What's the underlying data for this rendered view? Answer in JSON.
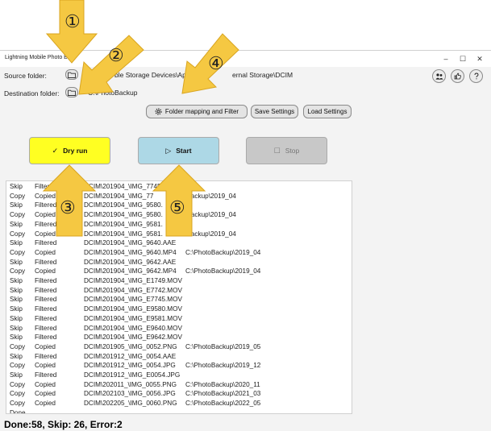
{
  "window": {
    "title": "Lightning Mobile Photo Ba",
    "controls": [
      "–",
      "☐",
      "✕"
    ]
  },
  "source": {
    "label": "Source folder:",
    "path": "ble Storage Devices\\App",
    "path_tail": "ernal Storage\\DCIM"
  },
  "destination": {
    "label": "Destination folder:",
    "path": "C:\\PhotoBackup"
  },
  "toolbar": {
    "mapping_label": "Folder mapping and Filter",
    "save_label": "Save Settings",
    "load_label": "Load Settings"
  },
  "actions": {
    "dry_run": "Dry run",
    "start": "Start",
    "stop": "Stop"
  },
  "colors": {
    "dry_run_bg": "#ffff22",
    "start_bg": "#add8e6",
    "stop_bg": "#c8c8c8",
    "callout": "#f5c842"
  },
  "callouts": [
    "①",
    "②",
    "③",
    "④",
    "⑤"
  ],
  "log": [
    [
      "Skip",
      "Filtered",
      "DCIM\\201904_\\IMG_7745",
      ""
    ],
    [
      "Copy",
      "Copied",
      "DCIM\\201904_\\IMG_77",
      "otoBackup\\2019_04"
    ],
    [
      "Skip",
      "Filtered",
      "DCIM\\201904_\\IMG_9580.",
      ""
    ],
    [
      "Copy",
      "Copied",
      "DCIM\\201904_\\IMG_9580.",
      "otoBackup\\2019_04"
    ],
    [
      "Skip",
      "Filtered",
      "DCIM\\201904_\\IMG_9581.",
      ""
    ],
    [
      "Copy",
      "Copied",
      "DCIM\\201904_\\IMG_9581.",
      "otoBackup\\2019_04"
    ],
    [
      "Skip",
      "Filtered",
      "DCIM\\201904_\\IMG_9640.AAE",
      ""
    ],
    [
      "Copy",
      "Copied",
      "DCIM\\201904_\\IMG_9640.MP4",
      "C:\\PhotoBackup\\2019_04"
    ],
    [
      "Skip",
      "Filtered",
      "DCIM\\201904_\\IMG_9642.AAE",
      ""
    ],
    [
      "Copy",
      "Copied",
      "DCIM\\201904_\\IMG_9642.MP4",
      "C:\\PhotoBackup\\2019_04"
    ],
    [
      "Skip",
      "Filtered",
      "DCIM\\201904_\\IMG_E1749.MOV",
      ""
    ],
    [
      "Skip",
      "Filtered",
      "DCIM\\201904_\\IMG_E7742.MOV",
      ""
    ],
    [
      "Skip",
      "Filtered",
      "DCIM\\201904_\\IMG_E7745.MOV",
      ""
    ],
    [
      "Skip",
      "Filtered",
      "DCIM\\201904_\\IMG_E9580.MOV",
      ""
    ],
    [
      "Skip",
      "Filtered",
      "DCIM\\201904_\\IMG_E9581.MOV",
      ""
    ],
    [
      "Skip",
      "Filtered",
      "DCIM\\201904_\\IMG_E9640.MOV",
      ""
    ],
    [
      "Skip",
      "Filtered",
      "DCIM\\201904_\\IMG_E9642.MOV",
      ""
    ],
    [
      "Copy",
      "Copied",
      "DCIM\\201905_\\IMG_0052.PNG",
      "C:\\PhotoBackup\\2019_05"
    ],
    [
      "Skip",
      "Filtered",
      "DCIM\\201912_\\IMG_0054.AAE",
      ""
    ],
    [
      "Copy",
      "Copied",
      "DCIM\\201912_\\IMG_0054.JPG",
      "C:\\PhotoBackup\\2019_12"
    ],
    [
      "Skip",
      "Filtered",
      "DCIM\\201912_\\IMG_E0054.JPG",
      ""
    ],
    [
      "Copy",
      "Copied",
      "DCIM\\202011_\\IMG_0055.PNG",
      "C:\\PhotoBackup\\2020_11"
    ],
    [
      "Copy",
      "Copied",
      "DCIM\\202103_\\IMG_0056.JPG",
      "C:\\PhotoBackup\\2021_03"
    ],
    [
      "Copy",
      "Copied",
      "DCIM\\202205_\\IMG_0060.PNG",
      "C:\\PhotoBackup\\2022_05"
    ],
    [
      "Done",
      "",
      "",
      ""
    ]
  ],
  "status": "Done:58, Skip: 26, Error:2"
}
